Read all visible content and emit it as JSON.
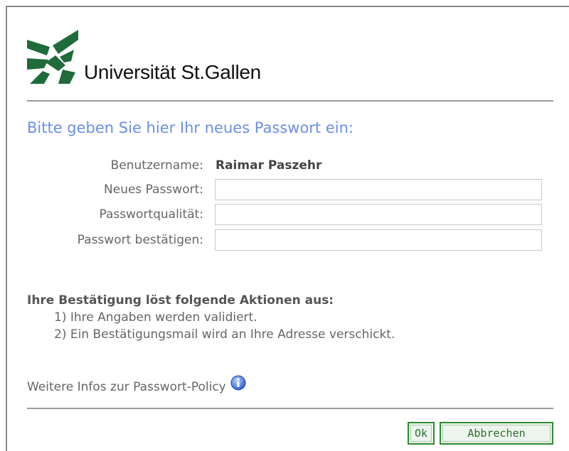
{
  "branding": {
    "university_name": "Universität St.Gallen",
    "logo_icon": "hsg-logo-icon",
    "logo_color": "#1f6b3a"
  },
  "form": {
    "heading": "Bitte geben Sie hier Ihr neues Passwort ein:",
    "username_label": "Benutzername:",
    "username_value": "Raimar Paszehr",
    "new_password_label": "Neues Passwort:",
    "new_password_value": "",
    "quality_label": "Passwortqualität:",
    "quality_value": "",
    "confirm_label": "Passwort bestätigen:",
    "confirm_value": ""
  },
  "info": {
    "title": "Ihre Bestätigung löst folgende Aktionen aus:",
    "items": [
      "1) Ihre Angaben werden validiert.",
      "2) Ein Bestätigungsmail wird an Ihre Adresse verschickt."
    ],
    "policy_text": "Weitere Infos zur Passwort-Policy",
    "policy_icon": "info-icon"
  },
  "buttons": {
    "ok_label": "Ok",
    "cancel_label": "Abbrechen"
  },
  "colors": {
    "heading": "#6a8fe6",
    "button_border": "#2f8a2f"
  }
}
